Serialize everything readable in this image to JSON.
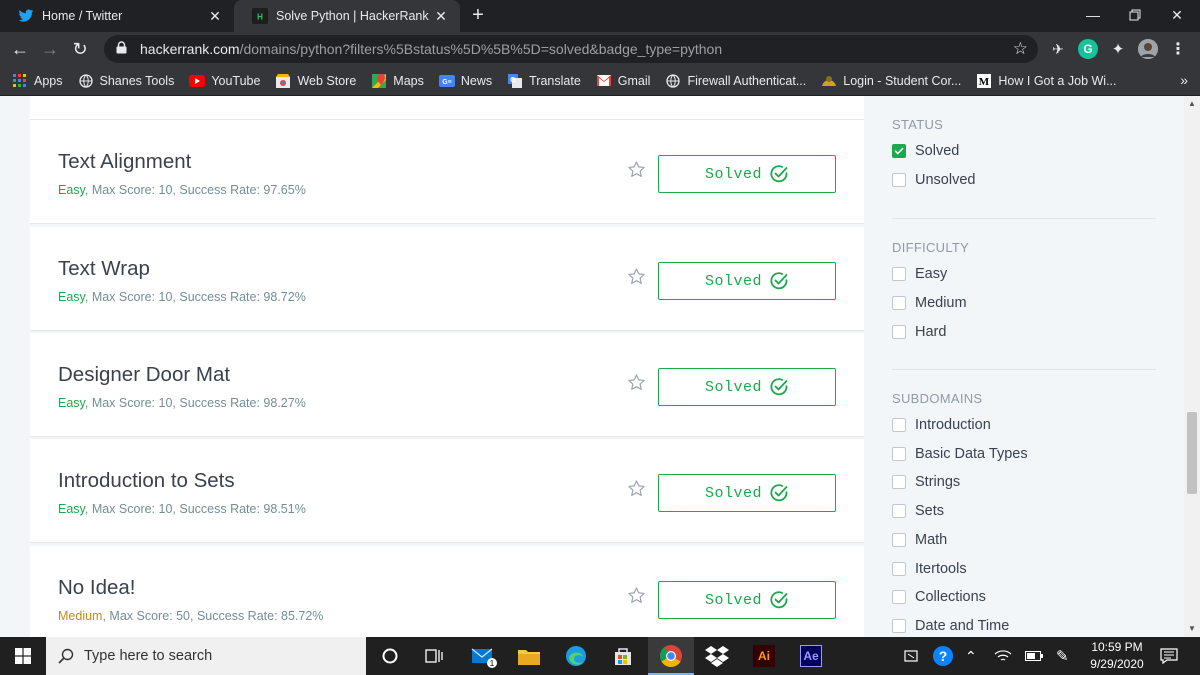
{
  "browser": {
    "tabs": [
      {
        "title": "Home / Twitter",
        "icon": "twitter-bird-icon",
        "active": false
      },
      {
        "title": "Solve Python | HackerRank",
        "icon": "hackerrank-logo-icon",
        "active": true
      }
    ],
    "url": {
      "host": "hackerrank.com",
      "path": "/domains/python?filters%5Bstatus%5D%5B%5D=solved&badge_type=python"
    },
    "bookmarks": [
      {
        "label": "Apps",
        "icon": "apps-grid-icon",
        "color": "#4285f4"
      },
      {
        "label": "Shanes Tools",
        "icon": "globe-icon",
        "color": "#e8eaed"
      },
      {
        "label": "YouTube",
        "icon": "youtube-icon",
        "color": "#ff0000"
      },
      {
        "label": "Web Store",
        "icon": "chrome-web-store-icon",
        "color": "#f4b400"
      },
      {
        "label": "Maps",
        "icon": "google-maps-icon",
        "color": "#34a853"
      },
      {
        "label": "News",
        "icon": "google-news-icon",
        "color": "#4285f4"
      },
      {
        "label": "Translate",
        "icon": "google-translate-icon",
        "color": "#4285f4"
      },
      {
        "label": "Gmail",
        "icon": "gmail-icon",
        "color": "#ea4335"
      },
      {
        "label": "Firewall Authenticat...",
        "icon": "globe-icon",
        "color": "#e8eaed"
      },
      {
        "label": "Login - Student Cor...",
        "icon": "student-portal-icon",
        "color": "#c9a227"
      },
      {
        "label": "How I Got a Job Wi...",
        "icon": "medium-logo-icon",
        "color": "#ffffff"
      }
    ],
    "bookmarks_more": "»"
  },
  "challenges": [
    {
      "name": "Text Alignment",
      "difficulty": "Easy",
      "rest": ", Max Score: 10, Success Rate: 97.65%",
      "status": "Solved"
    },
    {
      "name": "Text Wrap",
      "difficulty": "Easy",
      "rest": ", Max Score: 10, Success Rate: 98.72%",
      "status": "Solved"
    },
    {
      "name": "Designer Door Mat",
      "difficulty": "Easy",
      "rest": ", Max Score: 10, Success Rate: 98.27%",
      "status": "Solved"
    },
    {
      "name": "Introduction to Sets",
      "difficulty": "Easy",
      "rest": ", Max Score: 10, Success Rate: 98.51%",
      "status": "Solved"
    },
    {
      "name": "No Idea!",
      "difficulty": "Medium",
      "rest": ", Max Score: 50, Success Rate: 85.72%",
      "status": "Solved"
    }
  ],
  "filters": {
    "status": {
      "title": "STATUS",
      "options": [
        {
          "label": "Solved",
          "checked": true
        },
        {
          "label": "Unsolved",
          "checked": false
        }
      ]
    },
    "difficulty": {
      "title": "DIFFICULTY",
      "options": [
        {
          "label": "Easy",
          "checked": false
        },
        {
          "label": "Medium",
          "checked": false
        },
        {
          "label": "Hard",
          "checked": false
        }
      ]
    },
    "subdomains": {
      "title": "SUBDOMAINS",
      "options": [
        {
          "label": "Introduction",
          "checked": false
        },
        {
          "label": "Basic Data Types",
          "checked": false
        },
        {
          "label": "Strings",
          "checked": false
        },
        {
          "label": "Sets",
          "checked": false
        },
        {
          "label": "Math",
          "checked": false
        },
        {
          "label": "Itertools",
          "checked": false
        },
        {
          "label": "Collections",
          "checked": false
        },
        {
          "label": "Date and Time",
          "checked": false
        }
      ]
    }
  },
  "colors": {
    "accent_green": "#1ba94c",
    "medium_orange": "#c68b1a",
    "text_dark": "#39424e"
  },
  "taskbar": {
    "search_placeholder": "Type here to search",
    "mail_badge": "1",
    "apps": [
      "cortana-icon",
      "task-view-icon",
      "mail-icon",
      "file-explorer-icon",
      "edge-icon",
      "microsoft-store-icon",
      "chrome-icon",
      "dropbox-icon",
      "illustrator-icon",
      "after-effects-icon"
    ],
    "illustrator_label": "Ai",
    "after_effects_label": "Ae",
    "clock_time": "10:59 PM",
    "clock_date": "9/29/2020"
  }
}
